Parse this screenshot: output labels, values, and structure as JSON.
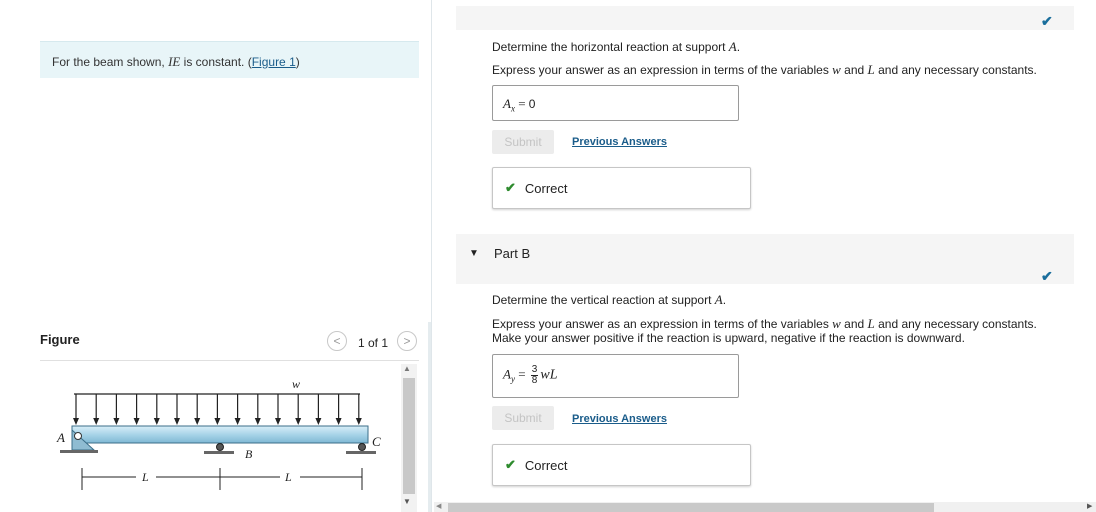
{
  "problem": {
    "text_before": "For the beam shown, ",
    "math": "IE",
    "text_after": " is constant. (",
    "link": "Figure 1",
    "text_close": ")"
  },
  "figure_pane": {
    "label": "Figure",
    "pager": {
      "count": "1 of 1",
      "prev": "<",
      "next": ">"
    },
    "diagram": {
      "load": "w",
      "point_a": "A",
      "point_b": "B",
      "point_c": "C",
      "span1": "L",
      "span2": "L"
    }
  },
  "part_a": {
    "question_prefix": "Determine the horizontal reaction at support ",
    "question_var": "A",
    "question_suffix": ".",
    "instruction_prefix": "Express your answer as an expression in terms of the variables ",
    "instruction_var1": "w",
    "instruction_mid": " and ",
    "instruction_var2": "L",
    "instruction_suffix": " and any necessary constants.",
    "answer_lhs": "A",
    "answer_sub": "x",
    "answer_eq": " = ",
    "answer_value": "0",
    "submit": "Submit",
    "previous_answers": "Previous Answers",
    "status": "Correct"
  },
  "part_b": {
    "title": "Part B",
    "question_prefix": "Determine the vertical reaction at support ",
    "question_var": "A",
    "question_suffix": ".",
    "instruction_prefix": "Express your answer as an expression in terms of the variables ",
    "instruction_var1": "w",
    "instruction_mid": " and ",
    "instruction_var2": "L",
    "instruction_suffix": " and any necessary constants.",
    "instruction_line2": "Make your answer positive if the reaction is upward, negative if the reaction is downward.",
    "answer_lhs": "A",
    "answer_sub": "y",
    "answer_eq": " = ",
    "answer_num": "3",
    "answer_den": "8",
    "answer_tail": "wL",
    "submit": "Submit",
    "previous_answers": "Previous Answers",
    "status": "Correct"
  },
  "icons": {
    "checkmark": "checkmark-icon",
    "triangle": "expand-triangle-icon"
  },
  "colors": {
    "accent": "#1a5c8a",
    "correct_green": "#2e8b2e",
    "problem_bg": "#e8f5f8",
    "beam": "#a8d4e8"
  }
}
